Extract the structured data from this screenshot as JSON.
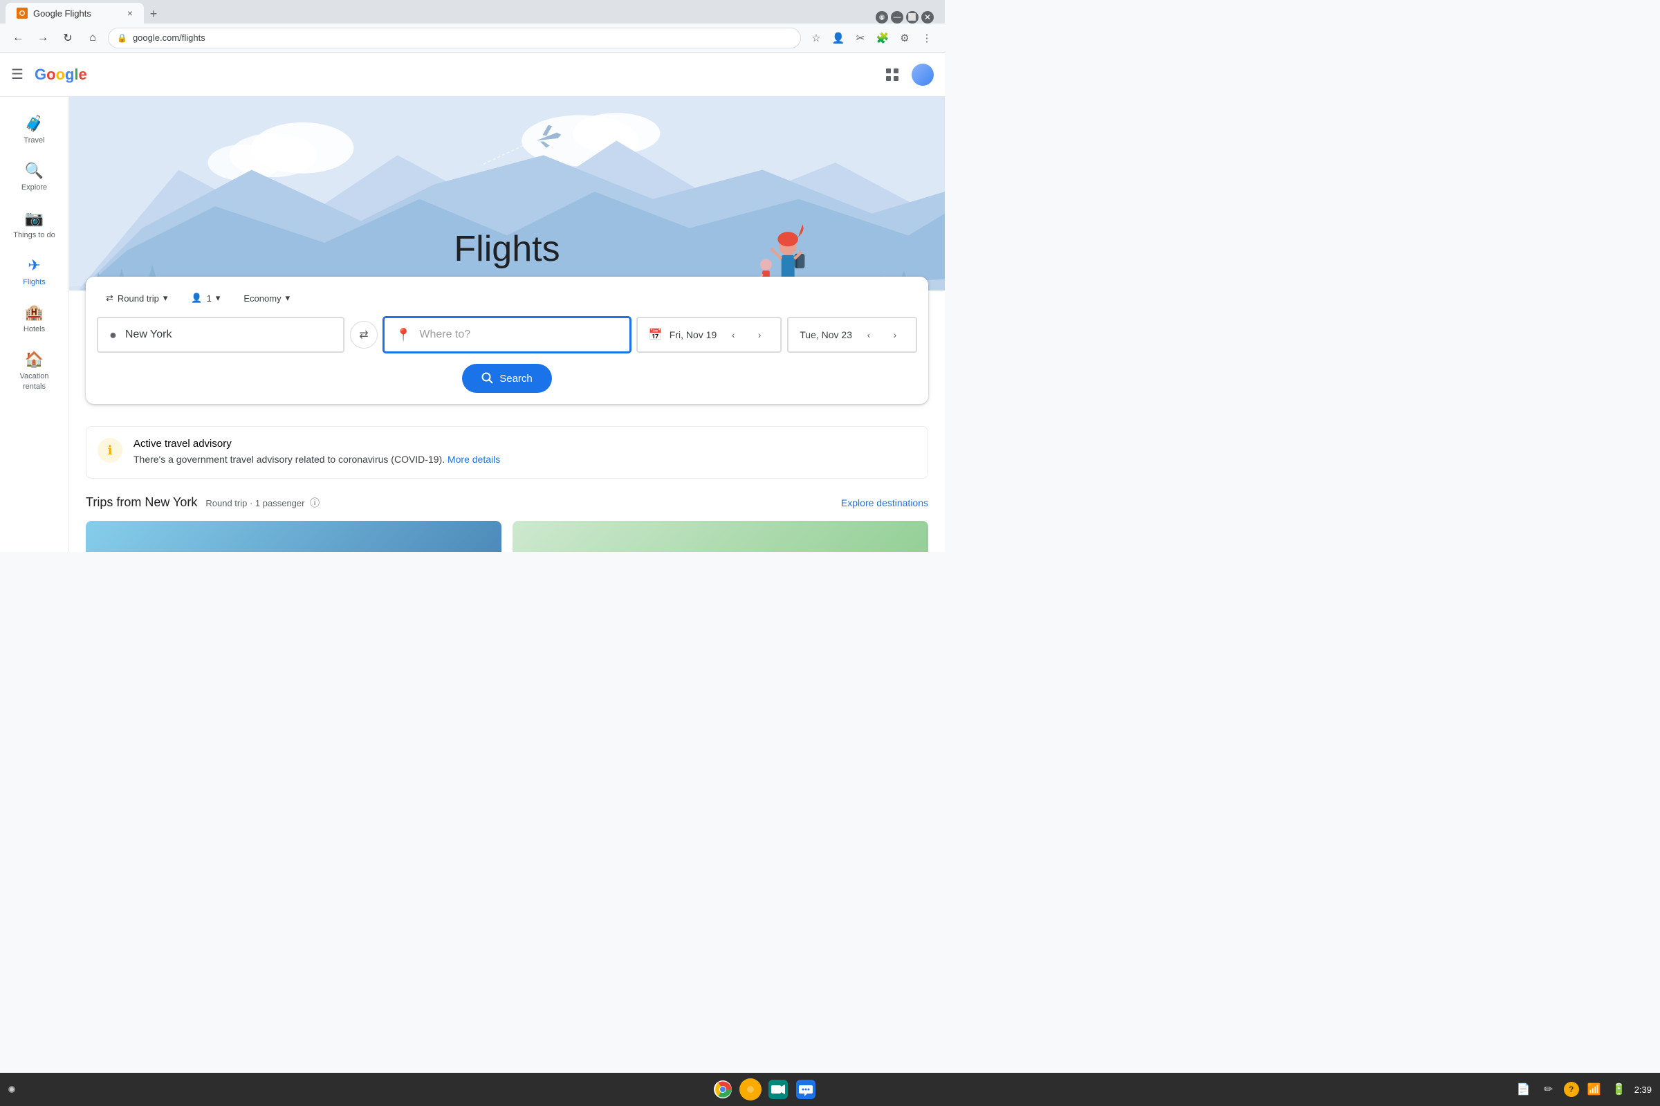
{
  "browser": {
    "tab_title": "Google Flights",
    "url": "google.com/flights",
    "new_tab_label": "+"
  },
  "google_bar": {
    "logo_letters": [
      {
        "char": "G",
        "color": "#4285f4"
      },
      {
        "char": "o",
        "color": "#ea4335"
      },
      {
        "char": "o",
        "color": "#fbbc05"
      },
      {
        "char": "g",
        "color": "#4285f4"
      },
      {
        "char": "l",
        "color": "#34a853"
      },
      {
        "char": "e",
        "color": "#ea4335"
      }
    ]
  },
  "sidebar": {
    "items": [
      {
        "id": "travel",
        "label": "Travel",
        "icon": "🧳"
      },
      {
        "id": "explore",
        "label": "Explore",
        "icon": "🔍"
      },
      {
        "id": "things-to-do",
        "label": "Things to do",
        "icon": "📷"
      },
      {
        "id": "flights",
        "label": "Flights",
        "icon": "✈️",
        "active": true
      },
      {
        "id": "hotels",
        "label": "Hotels",
        "icon": "🏨"
      },
      {
        "id": "vacation-rentals",
        "label": "Vacation rentals",
        "icon": "🏠"
      }
    ]
  },
  "hero": {
    "title": "Flights"
  },
  "search": {
    "trip_type": "Round trip",
    "passengers": "1",
    "cabin_class": "Economy",
    "origin": "New York",
    "destination_placeholder": "Where to?",
    "date_from": "Fri, Nov 19",
    "date_to": "Tue, Nov 23",
    "search_button": "Search"
  },
  "advisory": {
    "title": "Active travel advisory",
    "text": "There's a government travel advisory related to coronavirus (COVID-19).",
    "link_text": "More details"
  },
  "trips": {
    "title": "Trips from New York",
    "subtitle": "Round trip · 1 passenger",
    "explore_link": "Explore destinations"
  },
  "taskbar": {
    "time": "2:39",
    "apps": [
      {
        "id": "chrome",
        "color": "#4285f4"
      },
      {
        "id": "circle",
        "color": "#f9ab00"
      },
      {
        "id": "meet",
        "color": "#00897b"
      },
      {
        "id": "chat",
        "color": "#1a73e8"
      }
    ]
  }
}
